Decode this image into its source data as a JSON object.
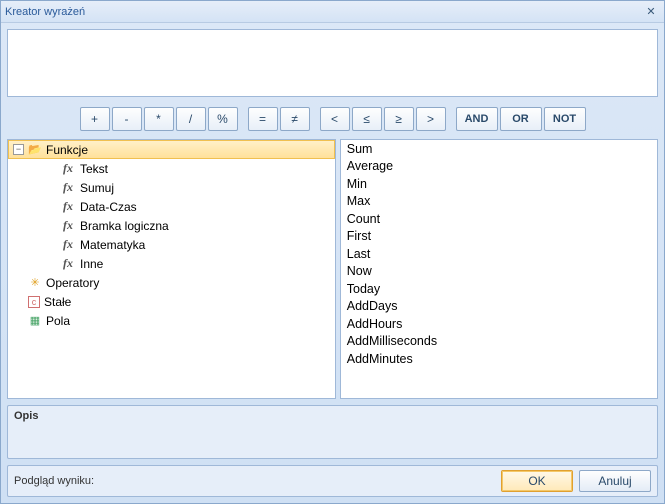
{
  "window": {
    "title": "Kreator wyrażeń"
  },
  "expression": {
    "value": ""
  },
  "ops": {
    "arith": [
      "+",
      "-",
      "*",
      "/",
      "%"
    ],
    "eq": [
      "=",
      "≠"
    ],
    "cmp": [
      "<",
      "≤",
      "≥",
      ">"
    ],
    "logic": [
      "AND",
      "OR",
      "NOT"
    ]
  },
  "tree": {
    "root": {
      "label": "Funkcje",
      "expanded": true
    },
    "children": [
      {
        "label": "Tekst"
      },
      {
        "label": "Sumuj"
      },
      {
        "label": "Data-Czas"
      },
      {
        "label": "Bramka logiczna"
      },
      {
        "label": "Matematyka"
      },
      {
        "label": "Inne"
      }
    ],
    "siblings": [
      {
        "label": "Operatory",
        "icon": "ops"
      },
      {
        "label": "Stałe",
        "icon": "const"
      },
      {
        "label": "Pola",
        "icon": "fields"
      }
    ]
  },
  "functions": [
    "Sum",
    "Average",
    "Min",
    "Max",
    "Count",
    "First",
    "Last",
    "Now",
    "Today",
    "AddDays",
    "AddHours",
    "AddMilliseconds",
    "AddMinutes"
  ],
  "description": {
    "title": "Opis"
  },
  "result": {
    "label": "Podgląd wyniku:"
  },
  "buttons": {
    "ok": "OK",
    "cancel": "Anuluj"
  }
}
